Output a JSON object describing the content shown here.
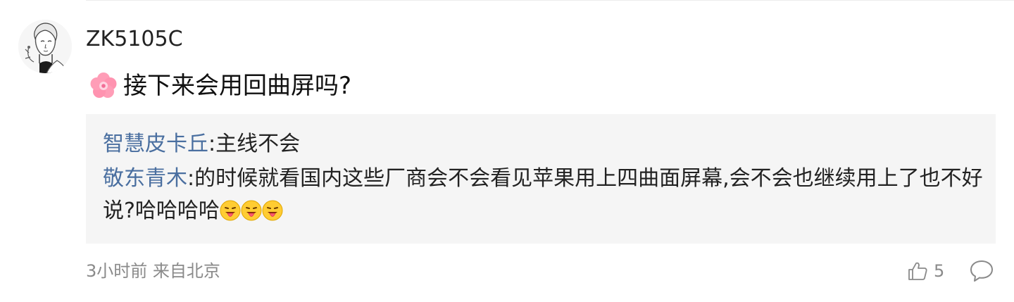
{
  "comment": {
    "username": "ZK5105C",
    "text": "接下来会用回曲屏吗?",
    "time": "3小时前",
    "location": "来自北京",
    "likes": "5"
  },
  "replies": [
    {
      "name": "智慧皮卡丘",
      "separator": ":",
      "text": "主线不会"
    },
    {
      "name": "敬东青木",
      "separator": ":",
      "text": "的时候就看国内这些厂商会不会看见苹果用上四曲面屏幕,会不会也继续用上了也不好说?哈哈哈哈"
    }
  ],
  "icons": {
    "comment_prefix": "flower-emoji",
    "reply_suffix": [
      "tongue-emoji",
      "tongue-emoji",
      "tongue-emoji"
    ],
    "like": "thumbs-up-icon",
    "reply": "speech-bubble-icon"
  },
  "colors": {
    "reply_name": "#4a6fa0",
    "reply_background": "#f5f5f5",
    "meta_text": "#8a8a8a"
  }
}
